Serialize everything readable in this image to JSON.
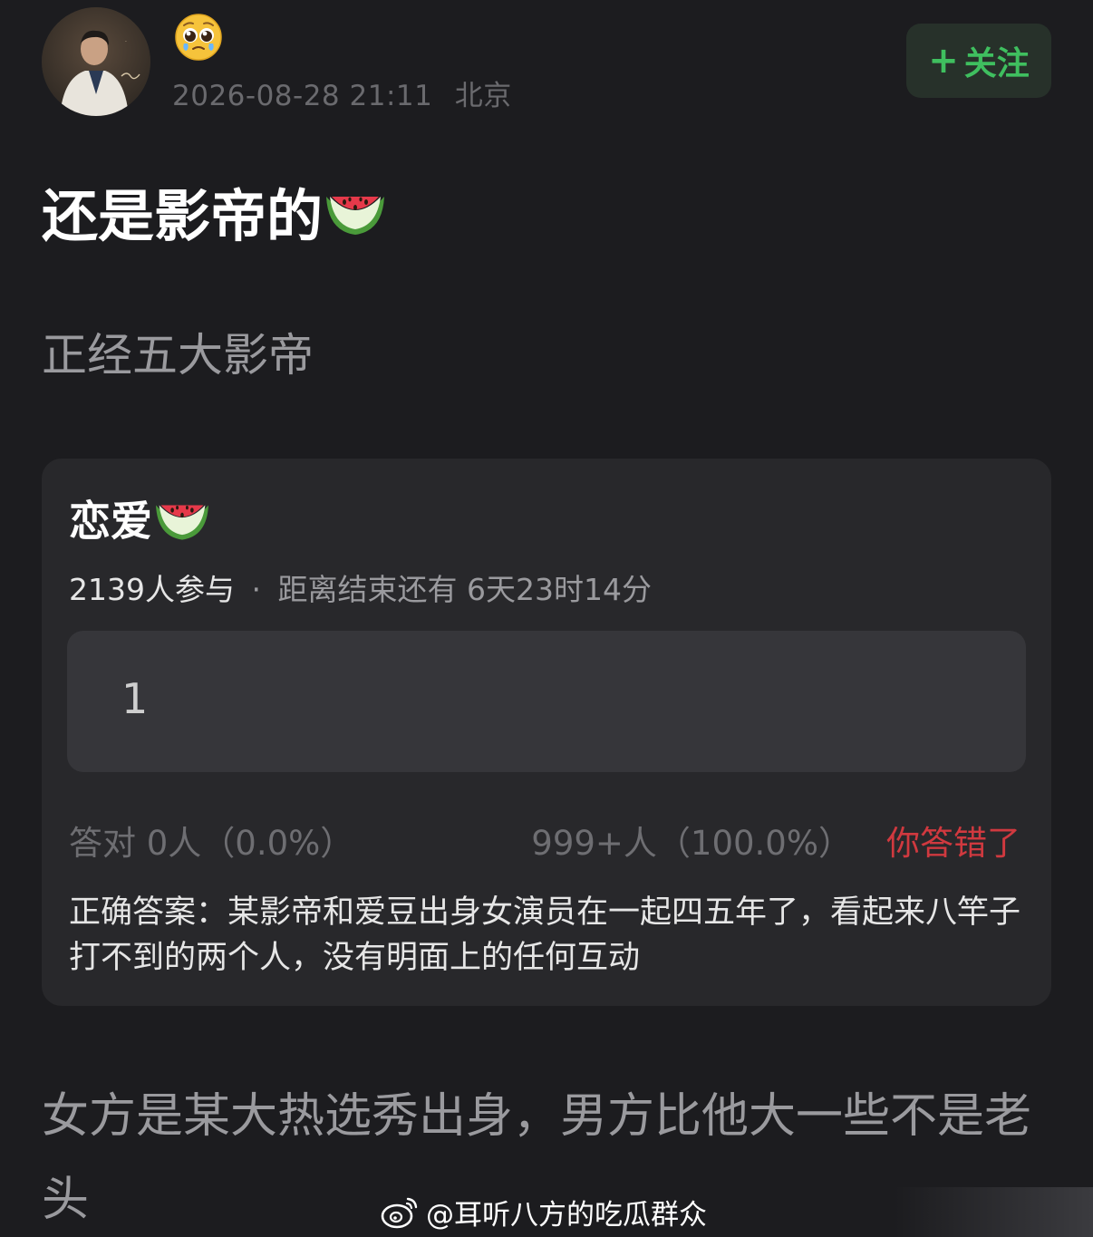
{
  "post": {
    "emoji": "pleading-face-emoji",
    "timestamp": "2026-08-28 21:11",
    "location": "北京",
    "follow_label": "关注",
    "title": "还是影帝的",
    "subtitle": "正经五大影帝",
    "body": "女方是某大热选秀出身，男方比他大一些不是老头"
  },
  "quiz": {
    "title": "恋爱",
    "participants": "2139人参与",
    "separator": "·",
    "remaining": "距离结束还有 6天23时14分",
    "option_label": "1",
    "correct_stats": "答对 0人（0.0%）",
    "option_stats": "999+人（100.0%）",
    "result": "你答错了",
    "answer": "正确答案：某影帝和爱豆出身女演员在一起四五年了，看起来八竿子打不到的两个人，没有明面上的任何互动"
  },
  "watermark": {
    "text": "@耳听八方的吃瓜群众"
  },
  "colors": {
    "background": "#1c1c1f",
    "card": "#28282b",
    "follow_green": "#3fbf5f",
    "wrong_red": "#d0393f"
  }
}
